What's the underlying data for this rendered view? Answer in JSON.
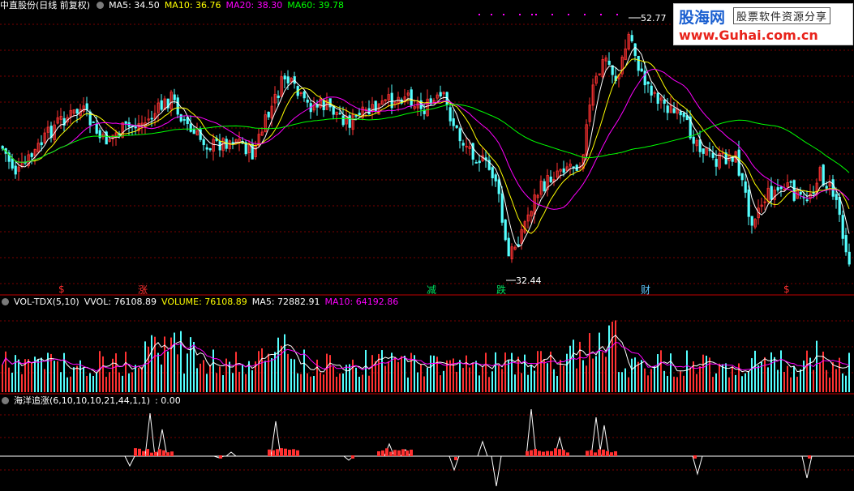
{
  "main_panel": {
    "stock_name": "中直股份(日线 前复权)",
    "indicators": [
      {
        "label": "MA5: 34.50",
        "color": "#ffffff"
      },
      {
        "label": "MA10: 36.76",
        "color": "#ffff00"
      },
      {
        "label": "MA20: 38.30",
        "color": "#ff00ff"
      },
      {
        "label": "MA60: 39.78",
        "color": "#00ff00"
      }
    ],
    "high_label": "52.77",
    "low_label": "32.44",
    "signals": [
      {
        "text": "$",
        "color": "#ff3030"
      },
      {
        "text": "涨",
        "color": "#ff3030"
      },
      {
        "text": "减",
        "color": "#00e060"
      },
      {
        "text": "跌",
        "color": "#00e060"
      },
      {
        "text": "财",
        "color": "#60c8ff"
      },
      {
        "text": "$",
        "color": "#ff3030"
      }
    ]
  },
  "volume_panel": {
    "name": "VOL-TDX(5,10)",
    "items": [
      {
        "label": "VVOL: 76108.89",
        "color": "#ffffff"
      },
      {
        "label": "VOLUME: 76108.89",
        "color": "#ffff00"
      },
      {
        "label": "MA5: 72882.91",
        "color": "#ffffff"
      },
      {
        "label": "MA10: 64192.86",
        "color": "#ff00ff"
      }
    ]
  },
  "indicator_panel": {
    "name": "海洋追涨(6,10,10,10,21,44,1,1)",
    "value": ": 0.00"
  },
  "logo": {
    "brand": "股海网",
    "tagline": "股票软件资源分享",
    "url": "www.Guhai.com.cn"
  },
  "colors": {
    "up": "#ff3232",
    "down": "#54ffff",
    "grid": "#7a0000",
    "panel_border": "#c00000"
  }
}
